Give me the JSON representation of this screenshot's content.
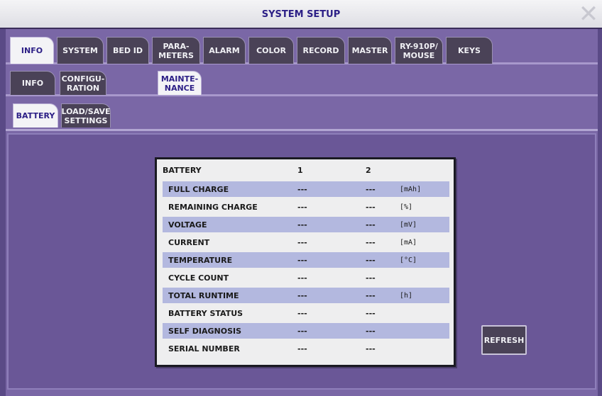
{
  "window": {
    "title": "SYSTEM SETUP",
    "close_glyph": "✕"
  },
  "tabs_main": [
    {
      "label": "INFO",
      "active": true
    },
    {
      "label": "SYSTEM"
    },
    {
      "label": "BED ID"
    },
    {
      "label": "PARA-\nMETERS"
    },
    {
      "label": "ALARM"
    },
    {
      "label": "COLOR"
    },
    {
      "label": "RECORD"
    },
    {
      "label": "MASTER"
    },
    {
      "label": "RY-910P/\nMOUSE"
    },
    {
      "label": "KEYS"
    }
  ],
  "tabs_sub": [
    {
      "label": "INFO"
    },
    {
      "label": "CONFIGU-\nRATION"
    },
    {
      "label": "MAINTE-\nNANCE",
      "active": true
    }
  ],
  "tabs_third": [
    {
      "label": "BATTERY",
      "active": true
    },
    {
      "label": "LOAD/SAVE\nSETTINGS"
    }
  ],
  "battery_table": {
    "header": {
      "label": "BATTERY",
      "col1": "1",
      "col2": "2"
    },
    "rows": [
      {
        "label": "FULL CHARGE",
        "v1": "---",
        "v2": "---",
        "unit": "[mAh]"
      },
      {
        "label": "REMAINING CHARGE",
        "v1": "---",
        "v2": "---",
        "unit": "[%]"
      },
      {
        "label": "VOLTAGE",
        "v1": "---",
        "v2": "---",
        "unit": "[mV]"
      },
      {
        "label": "CURRENT",
        "v1": "---",
        "v2": "---",
        "unit": "[mA]"
      },
      {
        "label": "TEMPERATURE",
        "v1": "---",
        "v2": "---",
        "unit": "[°C]"
      },
      {
        "label": "CYCLE COUNT",
        "v1": "---",
        "v2": "---",
        "unit": ""
      },
      {
        "label": "TOTAL RUNTIME",
        "v1": "---",
        "v2": "---",
        "unit": "[h]"
      },
      {
        "label": "BATTERY STATUS",
        "v1": "---",
        "v2": "---",
        "unit": ""
      },
      {
        "label": "SELF DIAGNOSIS",
        "v1": "---",
        "v2": "---",
        "unit": ""
      },
      {
        "label": "SERIAL NUMBER",
        "v1": "---",
        "v2": "---",
        "unit": ""
      }
    ]
  },
  "buttons": {
    "refresh": "REFRESH"
  }
}
